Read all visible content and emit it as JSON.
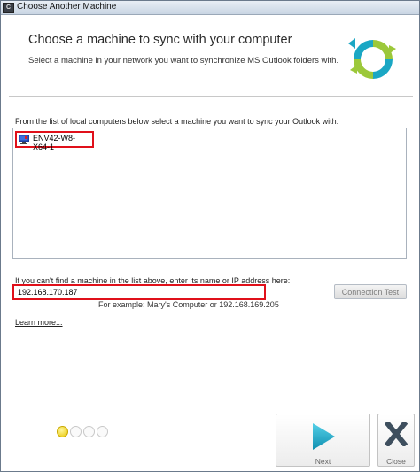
{
  "window": {
    "title": "Choose Another Machine",
    "icon": "app-icon"
  },
  "header": {
    "title": "Choose a machine to sync with your computer",
    "subtitle": "Select a machine in your network you want to synchronize MS Outlook folders with.",
    "logo_icon": "sync-arrows-icon"
  },
  "machine_list": {
    "label": "From the list of local computers below select a machine you want to sync your Outlook with:",
    "items": [
      {
        "name": "ENV42-W8-X64-1",
        "icon": "computer-icon"
      }
    ]
  },
  "manual_entry": {
    "label": "If you can't find a machine in the list above, enter its name or IP address here:",
    "value": "192.168.170.187",
    "example": "For example: Mary's Computer or 192.168.169.205",
    "connection_test_label": "Connection Test"
  },
  "learn_more": "Learn more...",
  "progress": {
    "steps": 4,
    "current": 1
  },
  "nav": {
    "next_label": "Next",
    "close_label": "Close"
  },
  "colors": {
    "highlight_border": "#e0101a",
    "next_arrow": "#1aa7c4",
    "close_x": "#3e4f5e",
    "logo_green": "#9cc83a",
    "logo_teal": "#1aa7c4"
  }
}
